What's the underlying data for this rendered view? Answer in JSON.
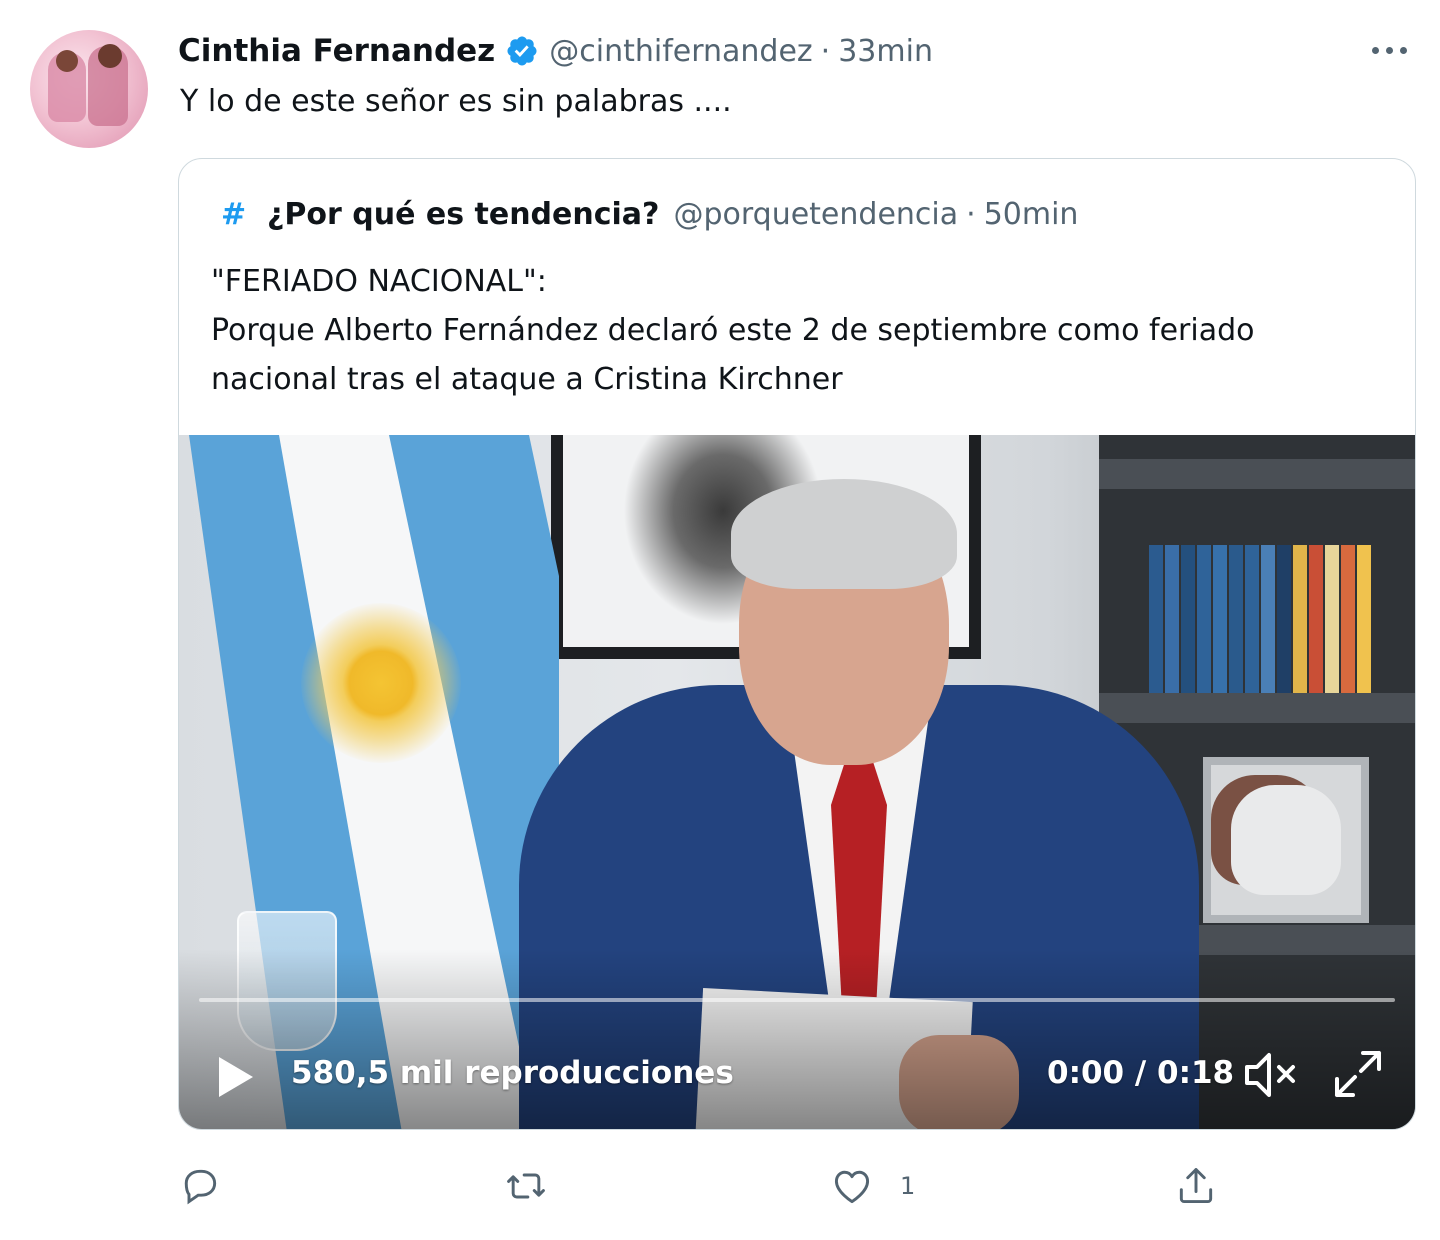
{
  "tweet": {
    "author": {
      "name": "Cinthia Fernandez",
      "handle": "@cinthifernandez",
      "verified": true
    },
    "separator": "·",
    "time": "33min",
    "text": "Y lo de este señor es sin palabras ....",
    "more_icon": "more-horizontal-icon"
  },
  "quoted_tweet": {
    "avatar_glyph": "#",
    "name": "¿Por qué es tendencia?",
    "handle": "@porquetendencia",
    "separator": "·",
    "time": "50min",
    "text_lines": [
      "\"FERIADO NACIONAL\":",
      "Porque Alberto Fernández declaró este 2 de septiembre como feriado",
      "nacional tras el ataque a Cristina Kirchner"
    ],
    "video": {
      "views": "580,5 mil reproducciones",
      "time": "0:00 / 0:18",
      "progress": 0,
      "play_icon": "play-icon",
      "mute_icon": "volume-muted-icon",
      "fullscreen_icon": "fullscreen-icon"
    }
  },
  "actions": {
    "reply": {
      "icon": "reply-icon",
      "count": ""
    },
    "retweet": {
      "icon": "retweet-icon",
      "count": ""
    },
    "like": {
      "icon": "heart-icon",
      "count": "1"
    },
    "share": {
      "icon": "share-icon",
      "count": ""
    }
  },
  "colors": {
    "accent": "#1d9bf0",
    "text_primary": "#0f1419",
    "text_secondary": "#536471",
    "border": "#cfd9de"
  }
}
